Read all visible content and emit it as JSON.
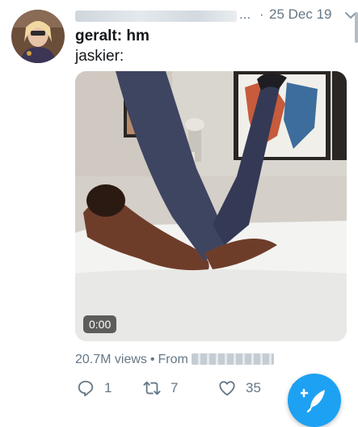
{
  "tweet": {
    "author_name_redacted": "",
    "ellipsis": "...",
    "separator": "·",
    "date": "25 Dec 19",
    "line1": "geralt: hm",
    "line2": "jaskier:",
    "video": {
      "duration": "0:00"
    },
    "views": "20.7M views",
    "views_separator": "•",
    "source_prefix": "From",
    "actions": {
      "reply_count": "1",
      "retweet_count": "7",
      "like_count": "35"
    }
  },
  "colors": {
    "accent": "#1da1f2",
    "secondary_text": "#657786",
    "primary_text": "#14171a"
  },
  "icons": {
    "menu": "chevron-down-icon",
    "reply": "reply-icon",
    "retweet": "retweet-icon",
    "like": "heart-icon",
    "share": "share-icon",
    "compose": "compose-tweet-icon"
  }
}
